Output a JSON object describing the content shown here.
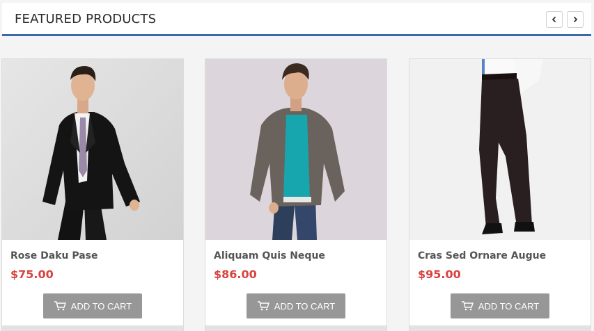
{
  "header": {
    "title": "FEATURED PRODUCTS",
    "prev_icon": "chevron-left-icon",
    "next_icon": "chevron-right-icon"
  },
  "products": [
    {
      "name": "Rose Daku Pase",
      "price": "$75.00",
      "cart_label": "ADD TO CART",
      "cart_icon": "cart-icon"
    },
    {
      "name": "Aliquam Quis Neque",
      "price": "$86.00",
      "cart_label": "ADD TO CART",
      "cart_icon": "cart-icon"
    },
    {
      "name": "Cras Sed Ornare Augue",
      "price": "$95.00",
      "cart_label": "ADD TO CART",
      "cart_icon": "cart-icon"
    }
  ],
  "colors": {
    "accent": "#3a68a8",
    "price": "#d9423f",
    "button": "#979797",
    "background": "#f4f4f5"
  }
}
